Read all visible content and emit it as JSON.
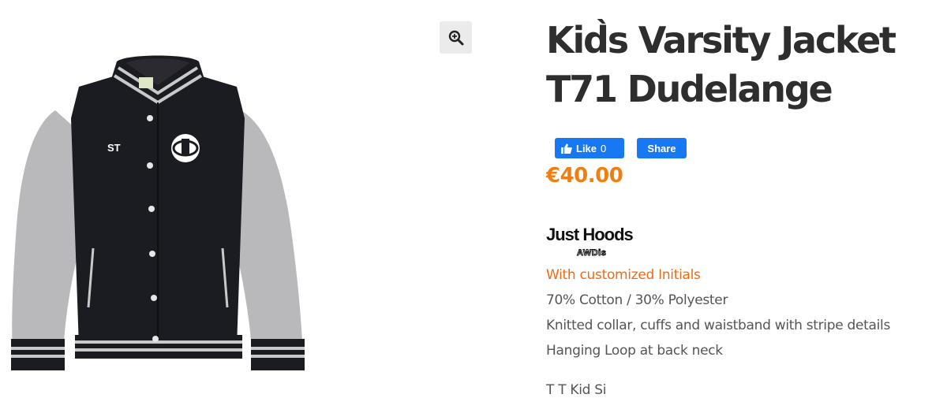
{
  "product": {
    "title_line1": "Kid̀s Varsity Jacket",
    "title_line2": "T71 Dudelange",
    "price": "€40.00",
    "brand": {
      "name": "Just Hoods",
      "sub": "AWDis"
    },
    "description": [
      "With  customized Initials",
      "70% Cotton / 30% Polyester",
      "Knitted collar, cuffs and waistband with stripe details",
      "Hanging Loop at back neck"
    ],
    "next_line_partial": "T  T  Kid  Si"
  },
  "social": {
    "like_label": "Like",
    "like_count": "0",
    "share_label": "Share"
  },
  "gallery": {
    "zoom_icon": "zoom-in-icon",
    "initials_on_jacket": "ST",
    "colors": {
      "body": "#1b1c21",
      "sleeves": "#b9b9bb",
      "stripe": "#c9c9c9",
      "accent_orange": "#f07f10",
      "facebook_blue": "#1877f2"
    }
  }
}
